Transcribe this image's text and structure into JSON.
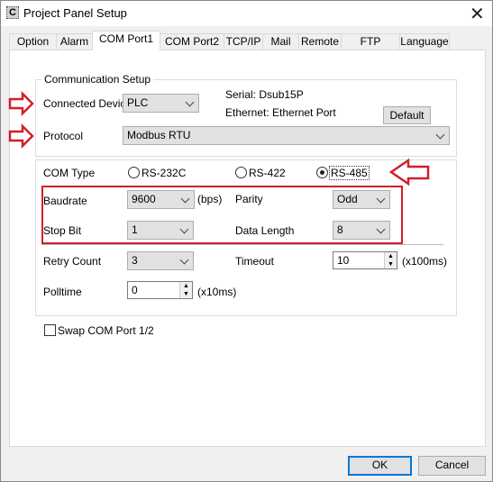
{
  "window": {
    "title": "Project Panel Setup",
    "icon_letter": "C",
    "close": "✕"
  },
  "tabs": [
    {
      "label": "Option"
    },
    {
      "label": "Alarm"
    },
    {
      "label": "COM Port1",
      "selected": true
    },
    {
      "label": "COM Port2"
    },
    {
      "label": "TCP/IP"
    },
    {
      "label": "Mail"
    },
    {
      "label": "Remote"
    },
    {
      "label": "FTP Service"
    },
    {
      "label": "Language"
    }
  ],
  "comm": {
    "group_label": "Communication Setup",
    "device_label": "Connected Device",
    "device_value": "PLC",
    "serial": "Serial: Dsub15P",
    "ethernet": "Ethernet: Ethernet Port",
    "default_button": "Default",
    "protocol_label": "Protocol",
    "protocol_value": "Modbus RTU"
  },
  "com": {
    "type_label": "COM Type",
    "types": [
      "RS-232C",
      "RS-422",
      "RS-485"
    ],
    "selected_type": "RS-485",
    "baudrate_label": "Baudrate",
    "baudrate": "9600",
    "bps": "(bps)",
    "parity_label": "Parity",
    "parity": "Odd",
    "stopbit_label": "Stop Bit",
    "stopbit": "1",
    "datalength_label": "Data Length",
    "datalength": "8",
    "retry_label": "Retry Count",
    "retry": "3",
    "timeout_label": "Timeout",
    "timeout": "10",
    "timeout_unit": "(x100ms)",
    "polltime_label": "Polltime",
    "polltime": "0",
    "polltime_unit": "(x10ms)"
  },
  "swap": {
    "label": "Swap COM Port 1/2",
    "checked": false
  },
  "footer": {
    "ok": "OK",
    "cancel": "Cancel"
  },
  "colors": {
    "annotation_red": "#d0202a",
    "accent": "#0078d7"
  }
}
